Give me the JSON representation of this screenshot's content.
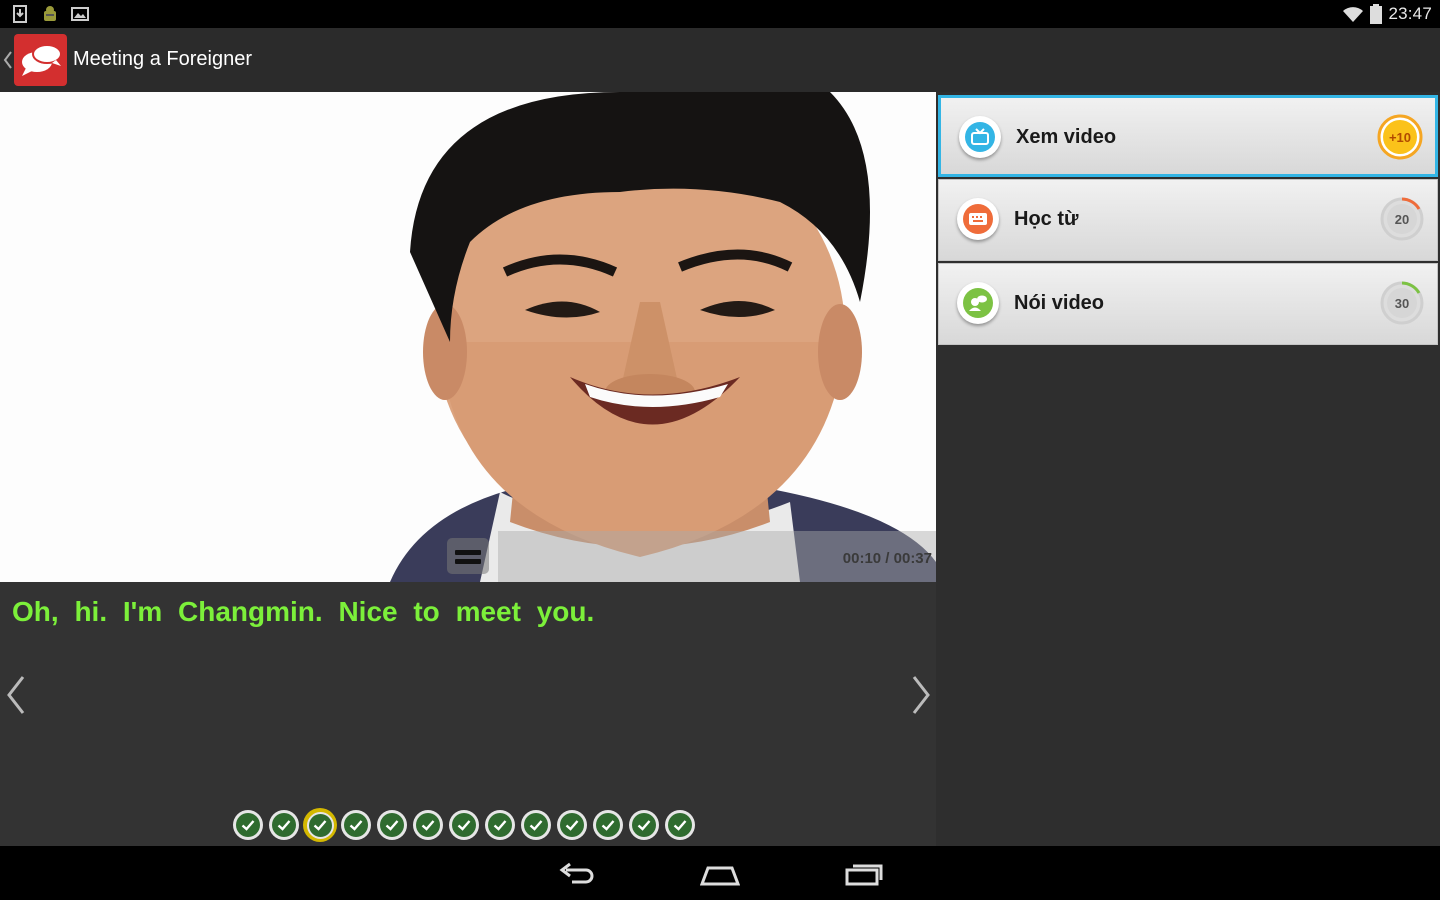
{
  "status_bar": {
    "left_icons": [
      "download-notification-icon",
      "android-debug-icon",
      "image-notification-icon"
    ],
    "clock": "23:47",
    "right_icons": [
      "wifi-icon",
      "battery-icon"
    ]
  },
  "action_bar": {
    "title": "Meeting a Foreigner",
    "app_icon": "speech-bubbles-icon"
  },
  "video": {
    "time": "00:10 / 00:37",
    "caption_toggle_icon": "subtitles-icon"
  },
  "subtitle": {
    "text": "Oh, hi. I'm Changmin. Nice to meet you.",
    "prev_icon": "chevron-left-icon",
    "next_icon": "chevron-right-icon",
    "color": "#7cf03a"
  },
  "progress": {
    "total": 13,
    "completed": 13,
    "current_index": 2
  },
  "sidebar": {
    "items": [
      {
        "label": "Xem video",
        "badge": "+10",
        "icon": "tv-icon",
        "active": true,
        "progress": 1.0,
        "color": "#33b5e5"
      },
      {
        "label": "Học từ",
        "badge": "20",
        "icon": "keyboard-icon",
        "active": false,
        "progress": 0.15,
        "color": "#ef6c3a"
      },
      {
        "label": "Nói video",
        "badge": "30",
        "icon": "chat-people-icon",
        "active": false,
        "progress": 0.15,
        "color": "#7cc243"
      }
    ]
  },
  "nav_bar": {
    "buttons": [
      "back-icon",
      "home-icon",
      "recents-icon"
    ]
  }
}
